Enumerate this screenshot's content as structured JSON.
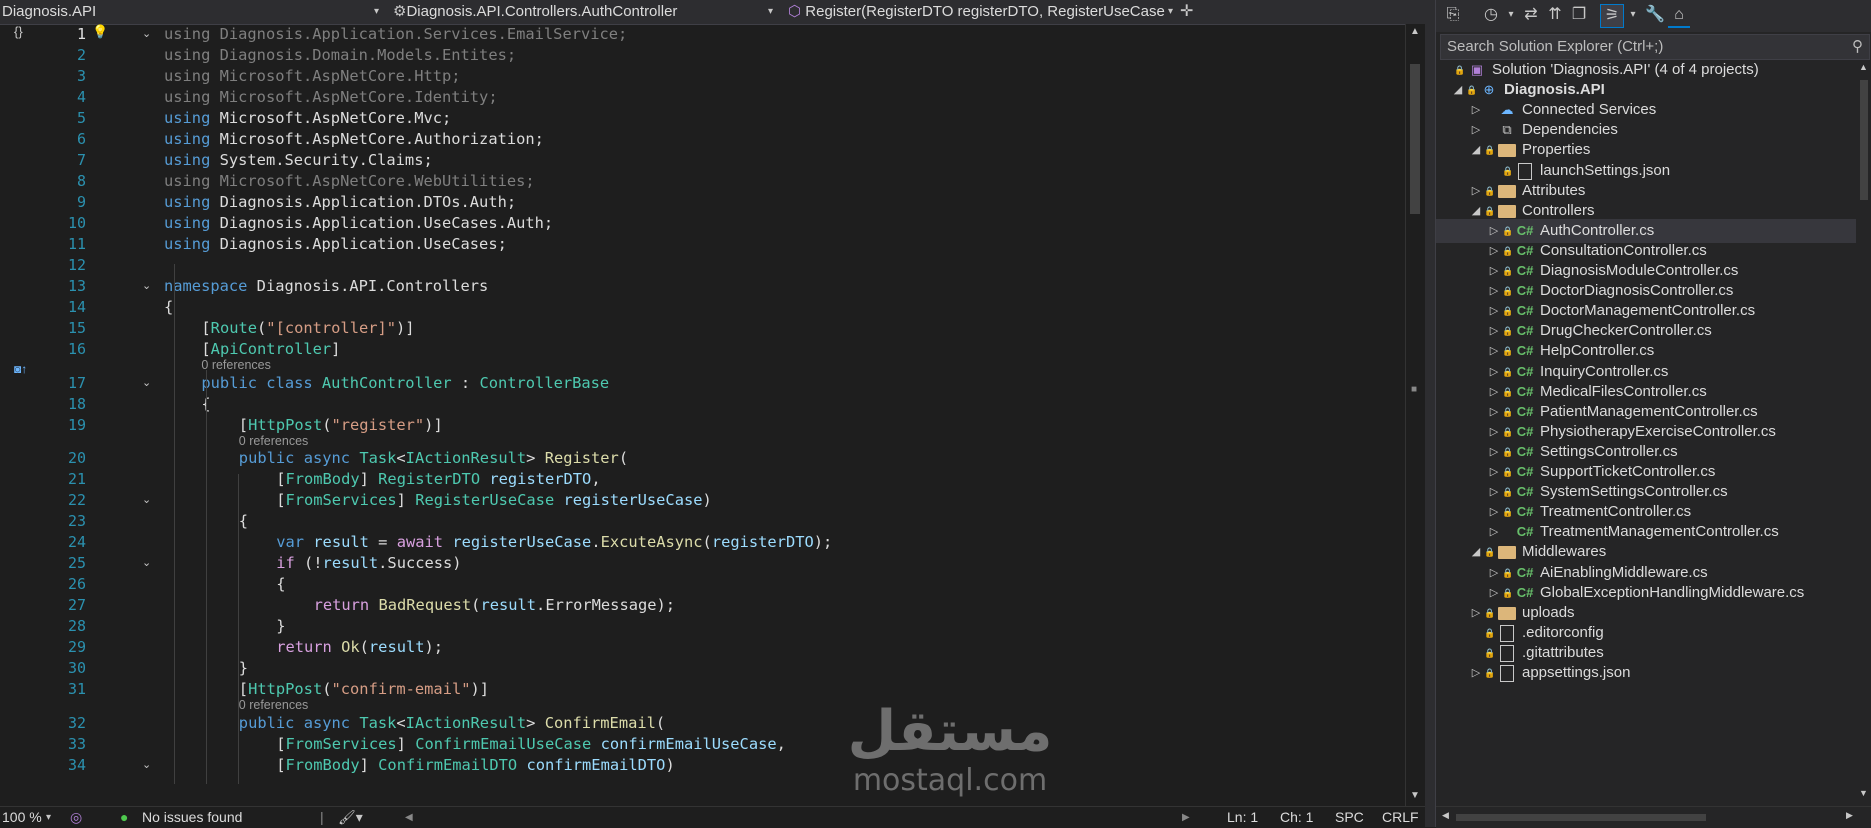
{
  "navbar": {
    "project": "Diagnosis.API",
    "class_path": "Diagnosis.API.Controllers.AuthController",
    "member": "Register(RegisterDTO registerDTO, RegisterUseCase registerUseC"
  },
  "code_lines": [
    {
      "n": "1",
      "cur": true,
      "fold": "v",
      "indent": 0,
      "tokens": [
        [
          "dim",
          "using"
        ],
        [
          "dim",
          " Diagnosis.Application.Services.EmailService;"
        ]
      ]
    },
    {
      "n": "2",
      "indent": 0,
      "tokens": [
        [
          "dim",
          "using"
        ],
        [
          "dim",
          " Diagnosis.Domain.Models.Entites;"
        ]
      ]
    },
    {
      "n": "3",
      "indent": 0,
      "tokens": [
        [
          "dim",
          "using"
        ],
        [
          "dim",
          " Microsoft.AspNetCore.Http;"
        ]
      ]
    },
    {
      "n": "4",
      "indent": 0,
      "tokens": [
        [
          "dim",
          "using"
        ],
        [
          "dim",
          " Microsoft.AspNetCore.Identity;"
        ]
      ]
    },
    {
      "n": "5",
      "indent": 0,
      "tokens": [
        [
          "kw",
          "using"
        ],
        [
          "pl",
          " Microsoft.AspNetCore.Mvc;"
        ]
      ]
    },
    {
      "n": "6",
      "indent": 0,
      "tokens": [
        [
          "kw",
          "using"
        ],
        [
          "pl",
          " Microsoft.AspNetCore.Authorization;"
        ]
      ]
    },
    {
      "n": "7",
      "indent": 0,
      "tokens": [
        [
          "kw",
          "using"
        ],
        [
          "pl",
          " System.Security.Claims;"
        ]
      ]
    },
    {
      "n": "8",
      "indent": 0,
      "tokens": [
        [
          "dim",
          "using"
        ],
        [
          "dim",
          " Microsoft.AspNetCore.WebUtilities;"
        ]
      ]
    },
    {
      "n": "9",
      "indent": 0,
      "tokens": [
        [
          "kw",
          "using"
        ],
        [
          "pl",
          " Diagnosis.Application.DTOs.Auth;"
        ]
      ]
    },
    {
      "n": "10",
      "indent": 0,
      "tokens": [
        [
          "kw",
          "using"
        ],
        [
          "pl",
          " Diagnosis.Application.UseCases.Auth;"
        ]
      ]
    },
    {
      "n": "11",
      "indent": 0,
      "tokens": [
        [
          "kw",
          "using"
        ],
        [
          "pl",
          " Diagnosis.Application.UseCases;"
        ]
      ]
    },
    {
      "n": "12",
      "indent": 0,
      "tokens": []
    },
    {
      "n": "13",
      "fold": "v",
      "indent": 0,
      "tokens": [
        [
          "kw",
          "namespace"
        ],
        [
          "pl",
          " Diagnosis.API.Controllers"
        ]
      ]
    },
    {
      "n": "14",
      "indent": 0,
      "tokens": [
        [
          "pl",
          "{"
        ]
      ]
    },
    {
      "n": "15",
      "indent": 1,
      "tokens": [
        [
          "pl",
          "["
        ],
        [
          "ty",
          "Route"
        ],
        [
          "pl",
          "("
        ],
        [
          "st",
          "\"[controller]\""
        ],
        [
          "pl",
          ")]"
        ]
      ]
    },
    {
      "n": "16",
      "indent": 1,
      "tokens": [
        [
          "pl",
          "["
        ],
        [
          "ty",
          "ApiController"
        ],
        [
          "pl",
          "]"
        ]
      ],
      "refs": "0 references"
    },
    {
      "n": "17",
      "fold": "v",
      "indent": 1,
      "tokens": [
        [
          "kw",
          "public"
        ],
        [
          "pl",
          " "
        ],
        [
          "kw",
          "class"
        ],
        [
          "pl",
          " "
        ],
        [
          "ty",
          "AuthController"
        ],
        [
          "pl",
          " : "
        ],
        [
          "ty",
          "ControllerBase"
        ]
      ]
    },
    {
      "n": "18",
      "indent": 1,
      "tokens": [
        [
          "pl",
          "{"
        ]
      ]
    },
    {
      "n": "19",
      "indent": 2,
      "tokens": [
        [
          "pl",
          "["
        ],
        [
          "ty",
          "HttpPost"
        ],
        [
          "pl",
          "("
        ],
        [
          "st",
          "\"register\""
        ],
        [
          "pl",
          ")]"
        ]
      ],
      "refs": "0 references"
    },
    {
      "n": "20",
      "indent": 2,
      "tokens": [
        [
          "kw",
          "public"
        ],
        [
          "pl",
          " "
        ],
        [
          "kw",
          "async"
        ],
        [
          "pl",
          " "
        ],
        [
          "ty",
          "Task"
        ],
        [
          "pl",
          "<"
        ],
        [
          "ty",
          "IActionResult"
        ],
        [
          "pl",
          "> "
        ],
        [
          "fn",
          "Register"
        ],
        [
          "pl",
          "("
        ]
      ]
    },
    {
      "n": "21",
      "indent": 3,
      "tokens": [
        [
          "pl",
          "["
        ],
        [
          "ty",
          "FromBody"
        ],
        [
          "pl",
          "] "
        ],
        [
          "ty",
          "RegisterDTO"
        ],
        [
          "pl",
          " "
        ],
        [
          "pr",
          "registerDTO"
        ],
        [
          "pl",
          ","
        ]
      ]
    },
    {
      "n": "22",
      "fold": "v",
      "indent": 3,
      "tokens": [
        [
          "pl",
          "["
        ],
        [
          "ty",
          "FromServices"
        ],
        [
          "pl",
          "] "
        ],
        [
          "ty",
          "RegisterUseCase"
        ],
        [
          "pl",
          " "
        ],
        [
          "pr",
          "registerUseCase"
        ],
        [
          "pl",
          ")"
        ]
      ]
    },
    {
      "n": "23",
      "indent": 2,
      "tokens": [
        [
          "pl",
          "{"
        ]
      ]
    },
    {
      "n": "24",
      "indent": 3,
      "tokens": [
        [
          "kw",
          "var"
        ],
        [
          "pl",
          " "
        ],
        [
          "pr",
          "result"
        ],
        [
          "pl",
          " = "
        ],
        [
          "cf",
          "await"
        ],
        [
          "pl",
          " "
        ],
        [
          "pr",
          "registerUseCase"
        ],
        [
          "pl",
          "."
        ],
        [
          "fn",
          "ExcuteAsync"
        ],
        [
          "pl",
          "("
        ],
        [
          "pr",
          "registerDTO"
        ],
        [
          "pl",
          ");"
        ]
      ]
    },
    {
      "n": "25",
      "fold": "v",
      "indent": 3,
      "tokens": [
        [
          "cf",
          "if"
        ],
        [
          "pl",
          " (!"
        ],
        [
          "pr",
          "result"
        ],
        [
          "pl",
          ".Success)"
        ]
      ]
    },
    {
      "n": "26",
      "indent": 3,
      "tokens": [
        [
          "pl",
          "{"
        ]
      ]
    },
    {
      "n": "27",
      "indent": 4,
      "tokens": [
        [
          "cf",
          "return"
        ],
        [
          "pl",
          " "
        ],
        [
          "fn",
          "BadRequest"
        ],
        [
          "pl",
          "("
        ],
        [
          "pr",
          "result"
        ],
        [
          "pl",
          ".ErrorMessage);"
        ]
      ]
    },
    {
      "n": "28",
      "indent": 3,
      "tokens": [
        [
          "pl",
          "}"
        ]
      ]
    },
    {
      "n": "29",
      "indent": 3,
      "tokens": [
        [
          "cf",
          "return"
        ],
        [
          "pl",
          " "
        ],
        [
          "fn",
          "Ok"
        ],
        [
          "pl",
          "("
        ],
        [
          "pr",
          "result"
        ],
        [
          "pl",
          ");"
        ]
      ]
    },
    {
      "n": "30",
      "indent": 2,
      "tokens": [
        [
          "pl",
          "}"
        ]
      ]
    },
    {
      "n": "31",
      "indent": 2,
      "tokens": [
        [
          "pl",
          "["
        ],
        [
          "ty",
          "HttpPost"
        ],
        [
          "pl",
          "("
        ],
        [
          "st",
          "\"confirm-email\""
        ],
        [
          "pl",
          ")]"
        ]
      ],
      "refs": "0 references"
    },
    {
      "n": "32",
      "indent": 2,
      "tokens": [
        [
          "kw",
          "public"
        ],
        [
          "pl",
          " "
        ],
        [
          "kw",
          "async"
        ],
        [
          "pl",
          " "
        ],
        [
          "ty",
          "Task"
        ],
        [
          "pl",
          "<"
        ],
        [
          "ty",
          "IActionResult"
        ],
        [
          "pl",
          "> "
        ],
        [
          "fn",
          "ConfirmEmail"
        ],
        [
          "pl",
          "("
        ]
      ]
    },
    {
      "n": "33",
      "indent": 3,
      "tokens": [
        [
          "pl",
          "["
        ],
        [
          "ty",
          "FromServices"
        ],
        [
          "pl",
          "] "
        ],
        [
          "ty",
          "ConfirmEmailUseCase"
        ],
        [
          "pl",
          " "
        ],
        [
          "pr",
          "confirmEmailUseCase"
        ],
        [
          "pl",
          ","
        ]
      ]
    },
    {
      "n": "34",
      "fold": "v",
      "indent": 3,
      "tokens": [
        [
          "pl",
          "["
        ],
        [
          "ty",
          "FromBody"
        ],
        [
          "pl",
          "] "
        ],
        [
          "ty",
          "ConfirmEmailDTO"
        ],
        [
          "pl",
          " "
        ],
        [
          "pr",
          "confirmEmailDTO"
        ],
        [
          "pl",
          ")"
        ]
      ]
    }
  ],
  "status": {
    "zoom": "100 %",
    "issues": "No issues found",
    "ln": "Ln: 1",
    "ch": "Ch: 1",
    "spc": "SPC",
    "eol": "CRLF"
  },
  "solution_explorer": {
    "search_placeholder": "Search Solution Explorer (Ctrl+;)",
    "items": [
      {
        "label": "Solution 'Diagnosis.API' (4 of 4 projects)",
        "level": 0,
        "icon": "solution-icon",
        "exp": "",
        "lock": true
      },
      {
        "label": "Diagnosis.API",
        "level": 1,
        "icon": "project-icon",
        "exp": "open",
        "lock": true,
        "bold": true
      },
      {
        "label": "Connected Services",
        "level": 2,
        "icon": "connected-services-icon",
        "exp": "closed",
        "lock": false
      },
      {
        "label": "Dependencies",
        "level": 2,
        "icon": "dependencies-icon",
        "exp": "closed",
        "lock": false
      },
      {
        "label": "Properties",
        "level": 2,
        "icon": "properties-icon",
        "exp": "open",
        "lock": true
      },
      {
        "label": "launchSettings.json",
        "level": 3,
        "icon": "json-file-icon",
        "exp": "",
        "lock": true
      },
      {
        "label": "Attributes",
        "level": 2,
        "icon": "folder-icon",
        "exp": "closed",
        "lock": true
      },
      {
        "label": "Controllers",
        "level": 2,
        "icon": "folder-icon",
        "exp": "open",
        "lock": true
      },
      {
        "label": "AuthController.cs",
        "level": 3,
        "icon": "csharp-file-icon",
        "exp": "closed",
        "lock": true,
        "selected": true
      },
      {
        "label": "ConsultationController.cs",
        "level": 3,
        "icon": "csharp-file-icon",
        "exp": "closed",
        "lock": true
      },
      {
        "label": "DiagnosisModuleController.cs",
        "level": 3,
        "icon": "csharp-file-icon",
        "exp": "closed",
        "lock": true
      },
      {
        "label": "DoctorDiagnosisController.cs",
        "level": 3,
        "icon": "csharp-file-icon",
        "exp": "closed",
        "lock": true
      },
      {
        "label": "DoctorManagementController.cs",
        "level": 3,
        "icon": "csharp-file-icon",
        "exp": "closed",
        "lock": true
      },
      {
        "label": "DrugCheckerController.cs",
        "level": 3,
        "icon": "csharp-file-icon",
        "exp": "closed",
        "lock": true
      },
      {
        "label": "HelpController.cs",
        "level": 3,
        "icon": "csharp-file-icon",
        "exp": "closed",
        "lock": true
      },
      {
        "label": "InquiryController.cs",
        "level": 3,
        "icon": "csharp-file-icon",
        "exp": "closed",
        "lock": true
      },
      {
        "label": "MedicalFilesController.cs",
        "level": 3,
        "icon": "csharp-file-icon",
        "exp": "closed",
        "lock": true
      },
      {
        "label": "PatientManagementController.cs",
        "level": 3,
        "icon": "csharp-file-icon",
        "exp": "closed",
        "lock": true
      },
      {
        "label": "PhysiotherapyExerciseController.cs",
        "level": 3,
        "icon": "csharp-file-icon",
        "exp": "closed",
        "lock": true
      },
      {
        "label": "SettingsController.cs",
        "level": 3,
        "icon": "csharp-file-icon",
        "exp": "closed",
        "lock": true
      },
      {
        "label": "SupportTicketController.cs",
        "level": 3,
        "icon": "csharp-file-icon",
        "exp": "closed",
        "lock": true
      },
      {
        "label": "SystemSettingsController.cs",
        "level": 3,
        "icon": "csharp-file-icon",
        "exp": "closed",
        "lock": true
      },
      {
        "label": "TreatmentController.cs",
        "level": 3,
        "icon": "csharp-file-icon",
        "exp": "closed",
        "lock": true
      },
      {
        "label": "TreatmentManagementController.cs",
        "level": 3,
        "icon": "csharp-file-icon",
        "exp": "closed",
        "lock": false
      },
      {
        "label": "Middlewares",
        "level": 2,
        "icon": "folder-icon",
        "exp": "open",
        "lock": true
      },
      {
        "label": "AiEnablingMiddleware.cs",
        "level": 3,
        "icon": "csharp-file-icon",
        "exp": "closed",
        "lock": true
      },
      {
        "label": "GlobalExceptionHandlingMiddleware.cs",
        "level": 3,
        "icon": "csharp-file-icon",
        "exp": "closed",
        "lock": true
      },
      {
        "label": "uploads",
        "level": 2,
        "icon": "folder-icon",
        "exp": "closed",
        "lock": true
      },
      {
        "label": ".editorconfig",
        "level": 2,
        "icon": "file-icon",
        "exp": "",
        "lock": true
      },
      {
        "label": ".gitattributes",
        "level": 2,
        "icon": "file-icon",
        "exp": "",
        "lock": true
      },
      {
        "label": "appsettings.json",
        "level": 2,
        "icon": "json-file-icon",
        "exp": "closed",
        "lock": true
      }
    ]
  },
  "watermark": {
    "arabic": "مستقل",
    "latin": "mostaql.com"
  },
  "colors": {
    "keyword": "#569cd6",
    "type": "#4ec9b0",
    "string": "#d69d85",
    "method": "#dcdcaa",
    "param": "#9cdcfe",
    "control": "#d8a0df",
    "line_number": "#2b91af"
  }
}
